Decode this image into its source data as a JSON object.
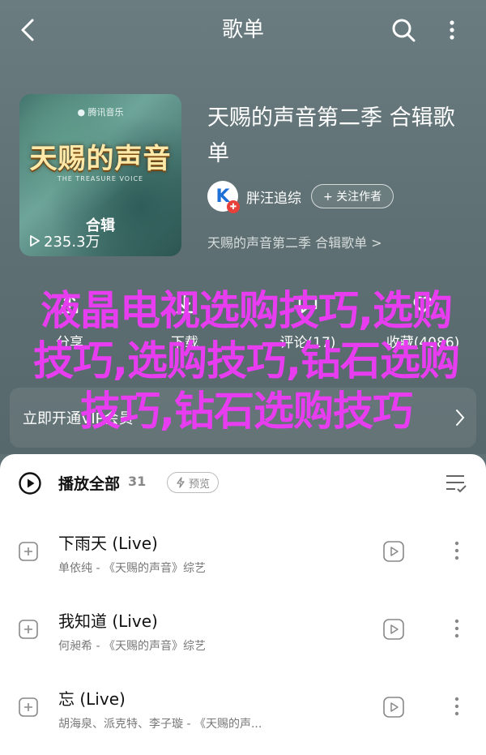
{
  "nav": {
    "title": "歌单"
  },
  "cover": {
    "badge": "● 腾讯音乐",
    "logo": "天赐的声音",
    "sub": "THE TREASURE VOICE",
    "edition": "合辑",
    "plays": "235.3万"
  },
  "album": {
    "title": "天赐的声音第二季 合辑歌单",
    "artist": "胖汪追综",
    "artist_avatar_letter": "K",
    "follow_label": "+ 关注作者",
    "desc": "天赐的声音第二季 合辑歌单 >"
  },
  "actions": [
    {
      "label": "分享",
      "icon": "share-icon"
    },
    {
      "label": "下载",
      "icon": "download-icon"
    },
    {
      "label": "评论(17)",
      "icon": "comment-icon"
    },
    {
      "label": "收藏(4086)",
      "icon": "favorite-icon"
    }
  ],
  "overlay_text": "液晶电视选购技巧,选购技巧,选购技巧,钻石选购技巧,钻石选购技巧",
  "promo": {
    "text": "立即开通VIP会员"
  },
  "list": {
    "playall_label": "播放全部",
    "count": "31",
    "preview_label": "预览"
  },
  "songs": [
    {
      "title": "下雨天 (Live)",
      "meta": "单依纯 - 《天赐的声音》综艺"
    },
    {
      "title": "我知道 (Live)",
      "meta": "何昶希 - 《天赐的声音》综艺"
    },
    {
      "title": "忘 (Live)",
      "meta": "胡海泉、派克特、李子璇 - 《天赐的声..."
    }
  ],
  "colors": {
    "header_bg": "#5f7174",
    "overlay": "#e83cf0",
    "vip_badge": "#e8403a"
  }
}
